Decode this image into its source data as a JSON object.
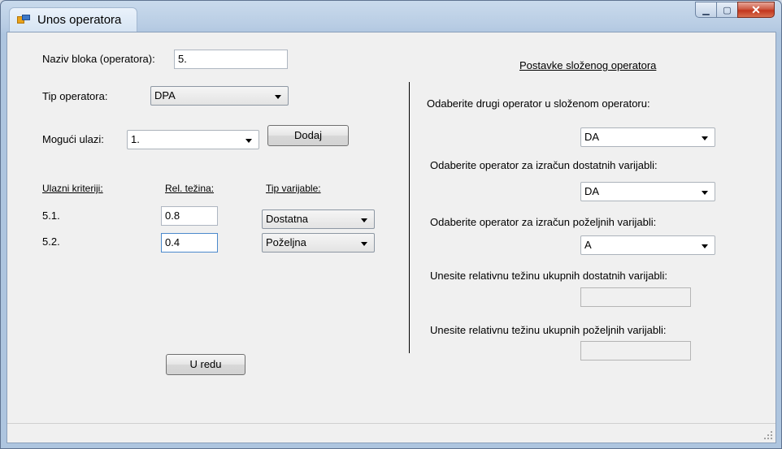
{
  "window": {
    "title": "Unos operatora"
  },
  "form": {
    "naziv_label": "Naziv bloka (operatora):",
    "naziv_value": "5.",
    "tip_label": "Tip operatora:",
    "tip_value": "DPA",
    "ulazi_label": "Mogući ulazi:",
    "ulazi_value": "1.",
    "dodaj_label": "Dodaj",
    "criteria_header": "Ulazni kriteriji:",
    "weight_header": "Rel. težina:",
    "vartype_header": "Tip varijable:",
    "rows": [
      {
        "id": "5.1.",
        "weight": "0.8",
        "type": "Dostatna"
      },
      {
        "id": "5.2.",
        "weight": "0.4",
        "type": "Poželjna"
      }
    ],
    "ok_label": "U redu"
  },
  "composite": {
    "title": "Postavke složenog operatora",
    "second_label": "Odaberite drugi operator u složenom operatoru:",
    "second_value": "DA",
    "sufficient_label": "Odaberite operator za izračun dostatnih varijabli:",
    "sufficient_value": "DA",
    "desirable_label": "Odaberite operator za izračun poželjnih varijabli:",
    "desirable_value": "A",
    "weight_sufficient_label": "Unesite relativnu težinu ukupnih dostatnih varijabli:",
    "weight_sufficient_value": "",
    "weight_desirable_label": "Unesite relativnu težinu ukupnih poželjnih varijabli:",
    "weight_desirable_value": ""
  }
}
